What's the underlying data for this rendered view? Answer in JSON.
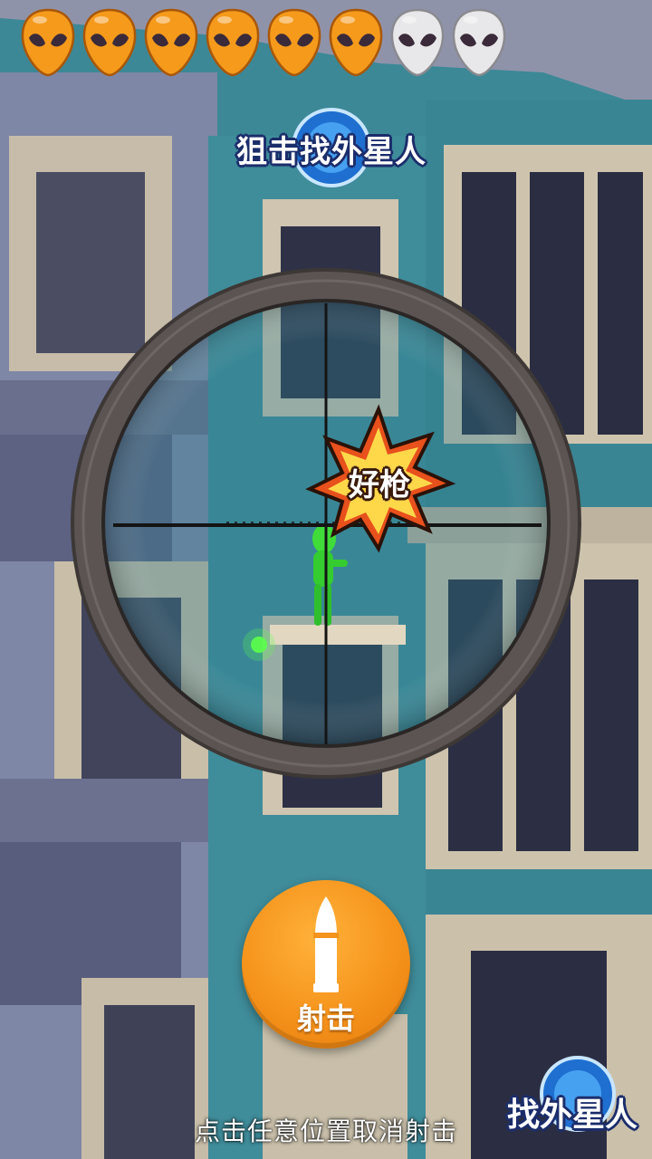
{
  "hud": {
    "aliens": [
      {
        "state": "found",
        "icon": "alien-head-icon"
      },
      {
        "state": "found",
        "icon": "alien-head-icon"
      },
      {
        "state": "found",
        "icon": "alien-head-icon"
      },
      {
        "state": "found",
        "icon": "alien-head-icon"
      },
      {
        "state": "found",
        "icon": "alien-head-icon"
      },
      {
        "state": "found",
        "icon": "alien-head-icon"
      },
      {
        "state": "hidden",
        "icon": "alien-head-icon"
      },
      {
        "state": "hidden",
        "icon": "alien-head-icon"
      }
    ],
    "found_color": "#f59a1b",
    "hidden_color": "#e8e8ea"
  },
  "title": {
    "text": "狙击找外星人"
  },
  "popup": {
    "text": "好枪",
    "color": "#e8501c"
  },
  "shoot_button": {
    "label": "射击",
    "icon": "bullet-icon",
    "color": "#f5931c"
  },
  "hint": {
    "text": "点击任意位置取消射击"
  },
  "footer_logo": {
    "text": "找外星人"
  }
}
